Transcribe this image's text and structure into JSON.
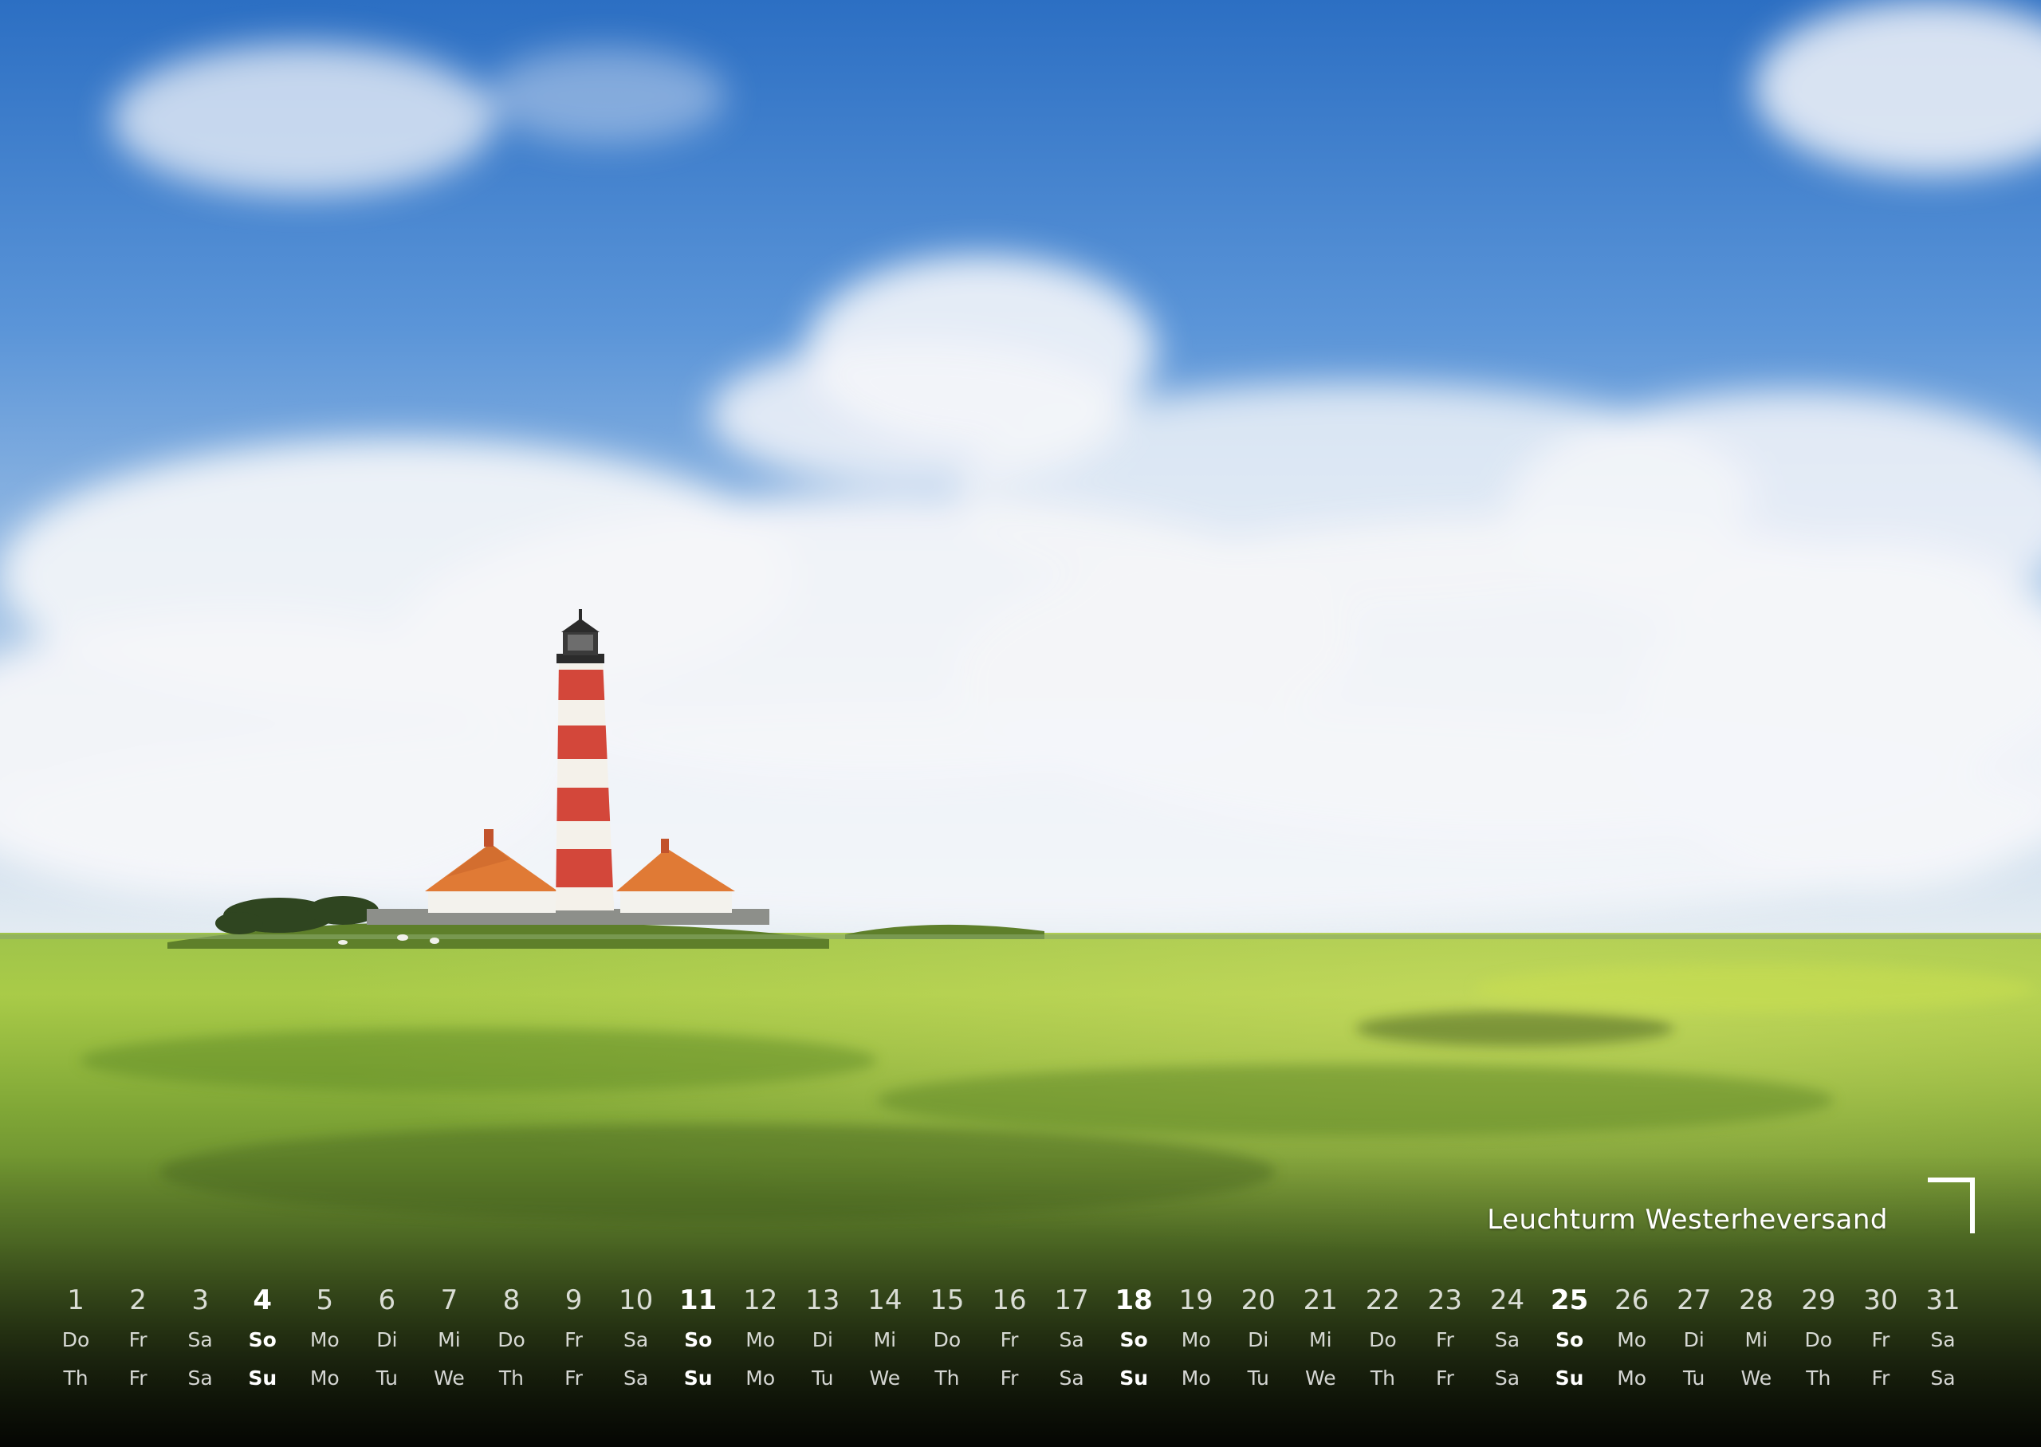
{
  "caption": "Leuchturm Westerheversand",
  "colors": {
    "sky_top": "#2c6fc3",
    "sky_mid": "#7eaee3",
    "cloud": "#f4f6f9",
    "grass_light": "#b6d34a",
    "grass_mid": "#6d9a2c",
    "grass_dark": "#1a2410",
    "lighthouse_red": "#d3473a",
    "roof_orange": "#e07a35",
    "text": "#ffffff"
  },
  "calendar": {
    "days": [
      {
        "num": "1",
        "de": "Do",
        "en": "Th",
        "sunday": false
      },
      {
        "num": "2",
        "de": "Fr",
        "en": "Fr",
        "sunday": false
      },
      {
        "num": "3",
        "de": "Sa",
        "en": "Sa",
        "sunday": false
      },
      {
        "num": "4",
        "de": "So",
        "en": "Su",
        "sunday": true
      },
      {
        "num": "5",
        "de": "Mo",
        "en": "Mo",
        "sunday": false
      },
      {
        "num": "6",
        "de": "Di",
        "en": "Tu",
        "sunday": false
      },
      {
        "num": "7",
        "de": "Mi",
        "en": "We",
        "sunday": false
      },
      {
        "num": "8",
        "de": "Do",
        "en": "Th",
        "sunday": false
      },
      {
        "num": "9",
        "de": "Fr",
        "en": "Fr",
        "sunday": false
      },
      {
        "num": "10",
        "de": "Sa",
        "en": "Sa",
        "sunday": false
      },
      {
        "num": "11",
        "de": "So",
        "en": "Su",
        "sunday": true
      },
      {
        "num": "12",
        "de": "Mo",
        "en": "Mo",
        "sunday": false
      },
      {
        "num": "13",
        "de": "Di",
        "en": "Tu",
        "sunday": false
      },
      {
        "num": "14",
        "de": "Mi",
        "en": "We",
        "sunday": false
      },
      {
        "num": "15",
        "de": "Do",
        "en": "Th",
        "sunday": false
      },
      {
        "num": "16",
        "de": "Fr",
        "en": "Fr",
        "sunday": false
      },
      {
        "num": "17",
        "de": "Sa",
        "en": "Sa",
        "sunday": false
      },
      {
        "num": "18",
        "de": "So",
        "en": "Su",
        "sunday": true
      },
      {
        "num": "19",
        "de": "Mo",
        "en": "Mo",
        "sunday": false
      },
      {
        "num": "20",
        "de": "Di",
        "en": "Tu",
        "sunday": false
      },
      {
        "num": "21",
        "de": "Mi",
        "en": "We",
        "sunday": false
      },
      {
        "num": "22",
        "de": "Do",
        "en": "Th",
        "sunday": false
      },
      {
        "num": "23",
        "de": "Fr",
        "en": "Fr",
        "sunday": false
      },
      {
        "num": "24",
        "de": "Sa",
        "en": "Sa",
        "sunday": false
      },
      {
        "num": "25",
        "de": "So",
        "en": "Su",
        "sunday": true
      },
      {
        "num": "26",
        "de": "Mo",
        "en": "Mo",
        "sunday": false
      },
      {
        "num": "27",
        "de": "Di",
        "en": "Tu",
        "sunday": false
      },
      {
        "num": "28",
        "de": "Mi",
        "en": "We",
        "sunday": false
      },
      {
        "num": "29",
        "de": "Do",
        "en": "Th",
        "sunday": false
      },
      {
        "num": "30",
        "de": "Fr",
        "en": "Fr",
        "sunday": false
      },
      {
        "num": "31",
        "de": "Sa",
        "en": "Sa",
        "sunday": false
      }
    ]
  }
}
